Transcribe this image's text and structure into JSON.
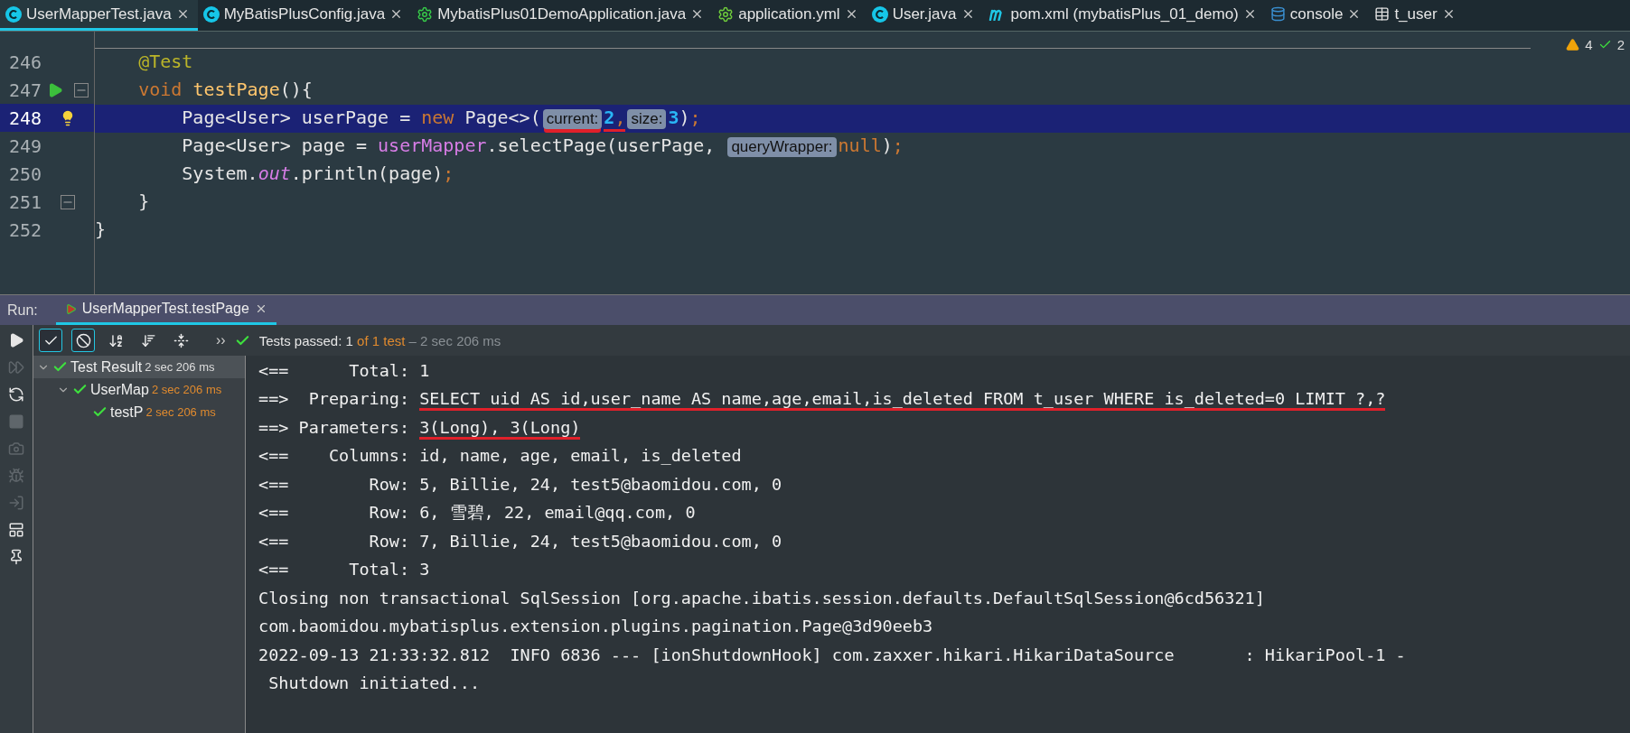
{
  "tabs": [
    {
      "label": "UserMapperTest.java",
      "kind": "class",
      "selected": true
    },
    {
      "label": "MyBatisPlusConfig.java",
      "kind": "class",
      "selected": false
    },
    {
      "label": "MybatisPlus01DemoApplication.java",
      "kind": "app",
      "selected": false
    },
    {
      "label": "application.yml",
      "kind": "config",
      "selected": false
    },
    {
      "label": "User.java",
      "kind": "class",
      "selected": false
    },
    {
      "label": "pom.xml (mybatisPlus_01_demo)",
      "kind": "maven",
      "selected": false
    },
    {
      "label": "console",
      "kind": "database",
      "selected": false
    },
    {
      "label": "t_user",
      "kind": "table",
      "selected": false
    }
  ],
  "inspections": {
    "warnings": "4",
    "checks": "2"
  },
  "editor": {
    "lines": [
      {
        "number": "246",
        "highlighted": false,
        "tokens": [
          {
            "kind": "annotation",
            "text": "    @Test"
          }
        ]
      },
      {
        "number": "247",
        "highlighted": false,
        "run": true,
        "fold": true,
        "tokens": [
          {
            "kind": "keyword",
            "text": "    void "
          },
          {
            "kind": "method",
            "text": "testPage"
          },
          {
            "kind": "plain",
            "text": "(){"
          }
        ]
      },
      {
        "number": "248",
        "highlighted": true,
        "bulb": true,
        "tokens": [
          {
            "kind": "plain",
            "text": "        Page<User> userPage = "
          },
          {
            "kind": "keyword",
            "text": "new "
          },
          {
            "kind": "plain",
            "text": "Page<>("
          },
          {
            "kind": "hint",
            "text": "current:",
            "underlined": true
          },
          {
            "kind": "number",
            "text": "2",
            "underlined": true
          },
          {
            "kind": "punct",
            "text": ",",
            "underlined": true
          },
          {
            "kind": "hint",
            "text": "size:"
          },
          {
            "kind": "number",
            "text": "3"
          },
          {
            "kind": "plain",
            "text": ")"
          },
          {
            "kind": "punct",
            "text": ";"
          }
        ]
      },
      {
        "number": "249",
        "highlighted": false,
        "tokens": [
          {
            "kind": "plain",
            "text": "        Page<User> page = "
          },
          {
            "kind": "field",
            "text": "userMapper"
          },
          {
            "kind": "plain",
            "text": ".selectPage(userPage, "
          },
          {
            "kind": "hint",
            "text": "queryWrapper:"
          },
          {
            "kind": "keyword",
            "text": "null"
          },
          {
            "kind": "plain",
            "text": ")"
          },
          {
            "kind": "punct",
            "text": ";"
          }
        ]
      },
      {
        "number": "250",
        "highlighted": false,
        "tokens": [
          {
            "kind": "plain",
            "text": "        System."
          },
          {
            "kind": "static",
            "text": "out"
          },
          {
            "kind": "plain",
            "text": ".println(page)"
          },
          {
            "kind": "punct",
            "text": ";"
          }
        ]
      },
      {
        "number": "251",
        "highlighted": false,
        "fold": true,
        "tokens": [
          {
            "kind": "plain",
            "text": "    }"
          }
        ]
      },
      {
        "number": "252",
        "highlighted": false,
        "tokens": [
          {
            "kind": "plain",
            "text": "}"
          }
        ]
      }
    ]
  },
  "run": {
    "label": "Run:",
    "tab": {
      "label": "UserMapperTest.testPage",
      "selected": true
    },
    "toolbar": [
      {
        "kind": "check",
        "on": true
      },
      {
        "kind": "ignore",
        "on": true
      },
      {
        "kind": "sort-alpha",
        "on": false
      },
      {
        "kind": "sort-duration",
        "on": false
      },
      {
        "kind": "expand",
        "on": false
      }
    ],
    "more": "››",
    "summary": {
      "label": "Tests passed: ",
      "passed": "1",
      "total": " of 1 test",
      "duration": " – 2 sec 206 ms"
    },
    "side_icons": [
      {
        "kind": "run",
        "disabled": false
      },
      {
        "kind": "rerun-failed",
        "disabled": true
      },
      {
        "kind": "toggle",
        "disabled": false
      },
      {
        "kind": "stop",
        "disabled": true
      },
      {
        "kind": "camera",
        "disabled": true
      },
      {
        "kind": "debug",
        "disabled": true
      },
      {
        "kind": "import",
        "disabled": true
      },
      {
        "kind": "layout",
        "disabled": false
      },
      {
        "kind": "pin",
        "disabled": false
      }
    ],
    "tree": [
      {
        "label": "Test Result",
        "time": "2 sec 206 ms",
        "selected": true,
        "expanded": true,
        "children": [
          {
            "label": "UserMap",
            "time": "2 sec 206 ms",
            "selected": false,
            "expanded": true,
            "children": [
              {
                "label": "testP",
                "time": "2 sec 206 ms",
                "selected": false
              }
            ]
          }
        ]
      }
    ],
    "console": [
      [
        {
          "text": "<==      Total: 1"
        }
      ],
      [
        {
          "text": "==>  Preparing: "
        },
        {
          "text": "SELECT uid AS id,user_name AS name,age,email,is_deleted FROM t_user WHERE is_deleted=0 LIMIT ?,?",
          "underlined": true
        }
      ],
      [
        {
          "text": "==> Parameters: "
        },
        {
          "text": "3(Long), 3(Long)",
          "underlined": true
        }
      ],
      [
        {
          "text": "<==    Columns: id, name, age, email, is_deleted"
        }
      ],
      [
        {
          "text": "<==        Row: 5, Billie, 24, test5@baomidou.com, 0"
        }
      ],
      [
        {
          "text": "<==        Row: 6, 雪碧, 22, email@qq.com, 0"
        }
      ],
      [
        {
          "text": "<==        Row: 7, Billie, 24, test5@baomidou.com, 0"
        }
      ],
      [
        {
          "text": "<==      Total: 3"
        }
      ],
      [
        {
          "text": "Closing non transactional SqlSession [org.apache.ibatis.session.defaults.DefaultSqlSession@6cd56321]"
        }
      ],
      [
        {
          "text": "com.baomidou.mybatisplus.extension.plugins.pagination.Page@3d90eeb3"
        }
      ],
      [
        {
          "text": "2022-09-13 21:33:32.812  INFO 6836 --- [ionShutdownHook] com.zaxxer.hikari.HikariDataSource       : HikariPool-1 -"
        }
      ],
      [
        {
          "text": " Shutdown initiated..."
        }
      ]
    ]
  }
}
